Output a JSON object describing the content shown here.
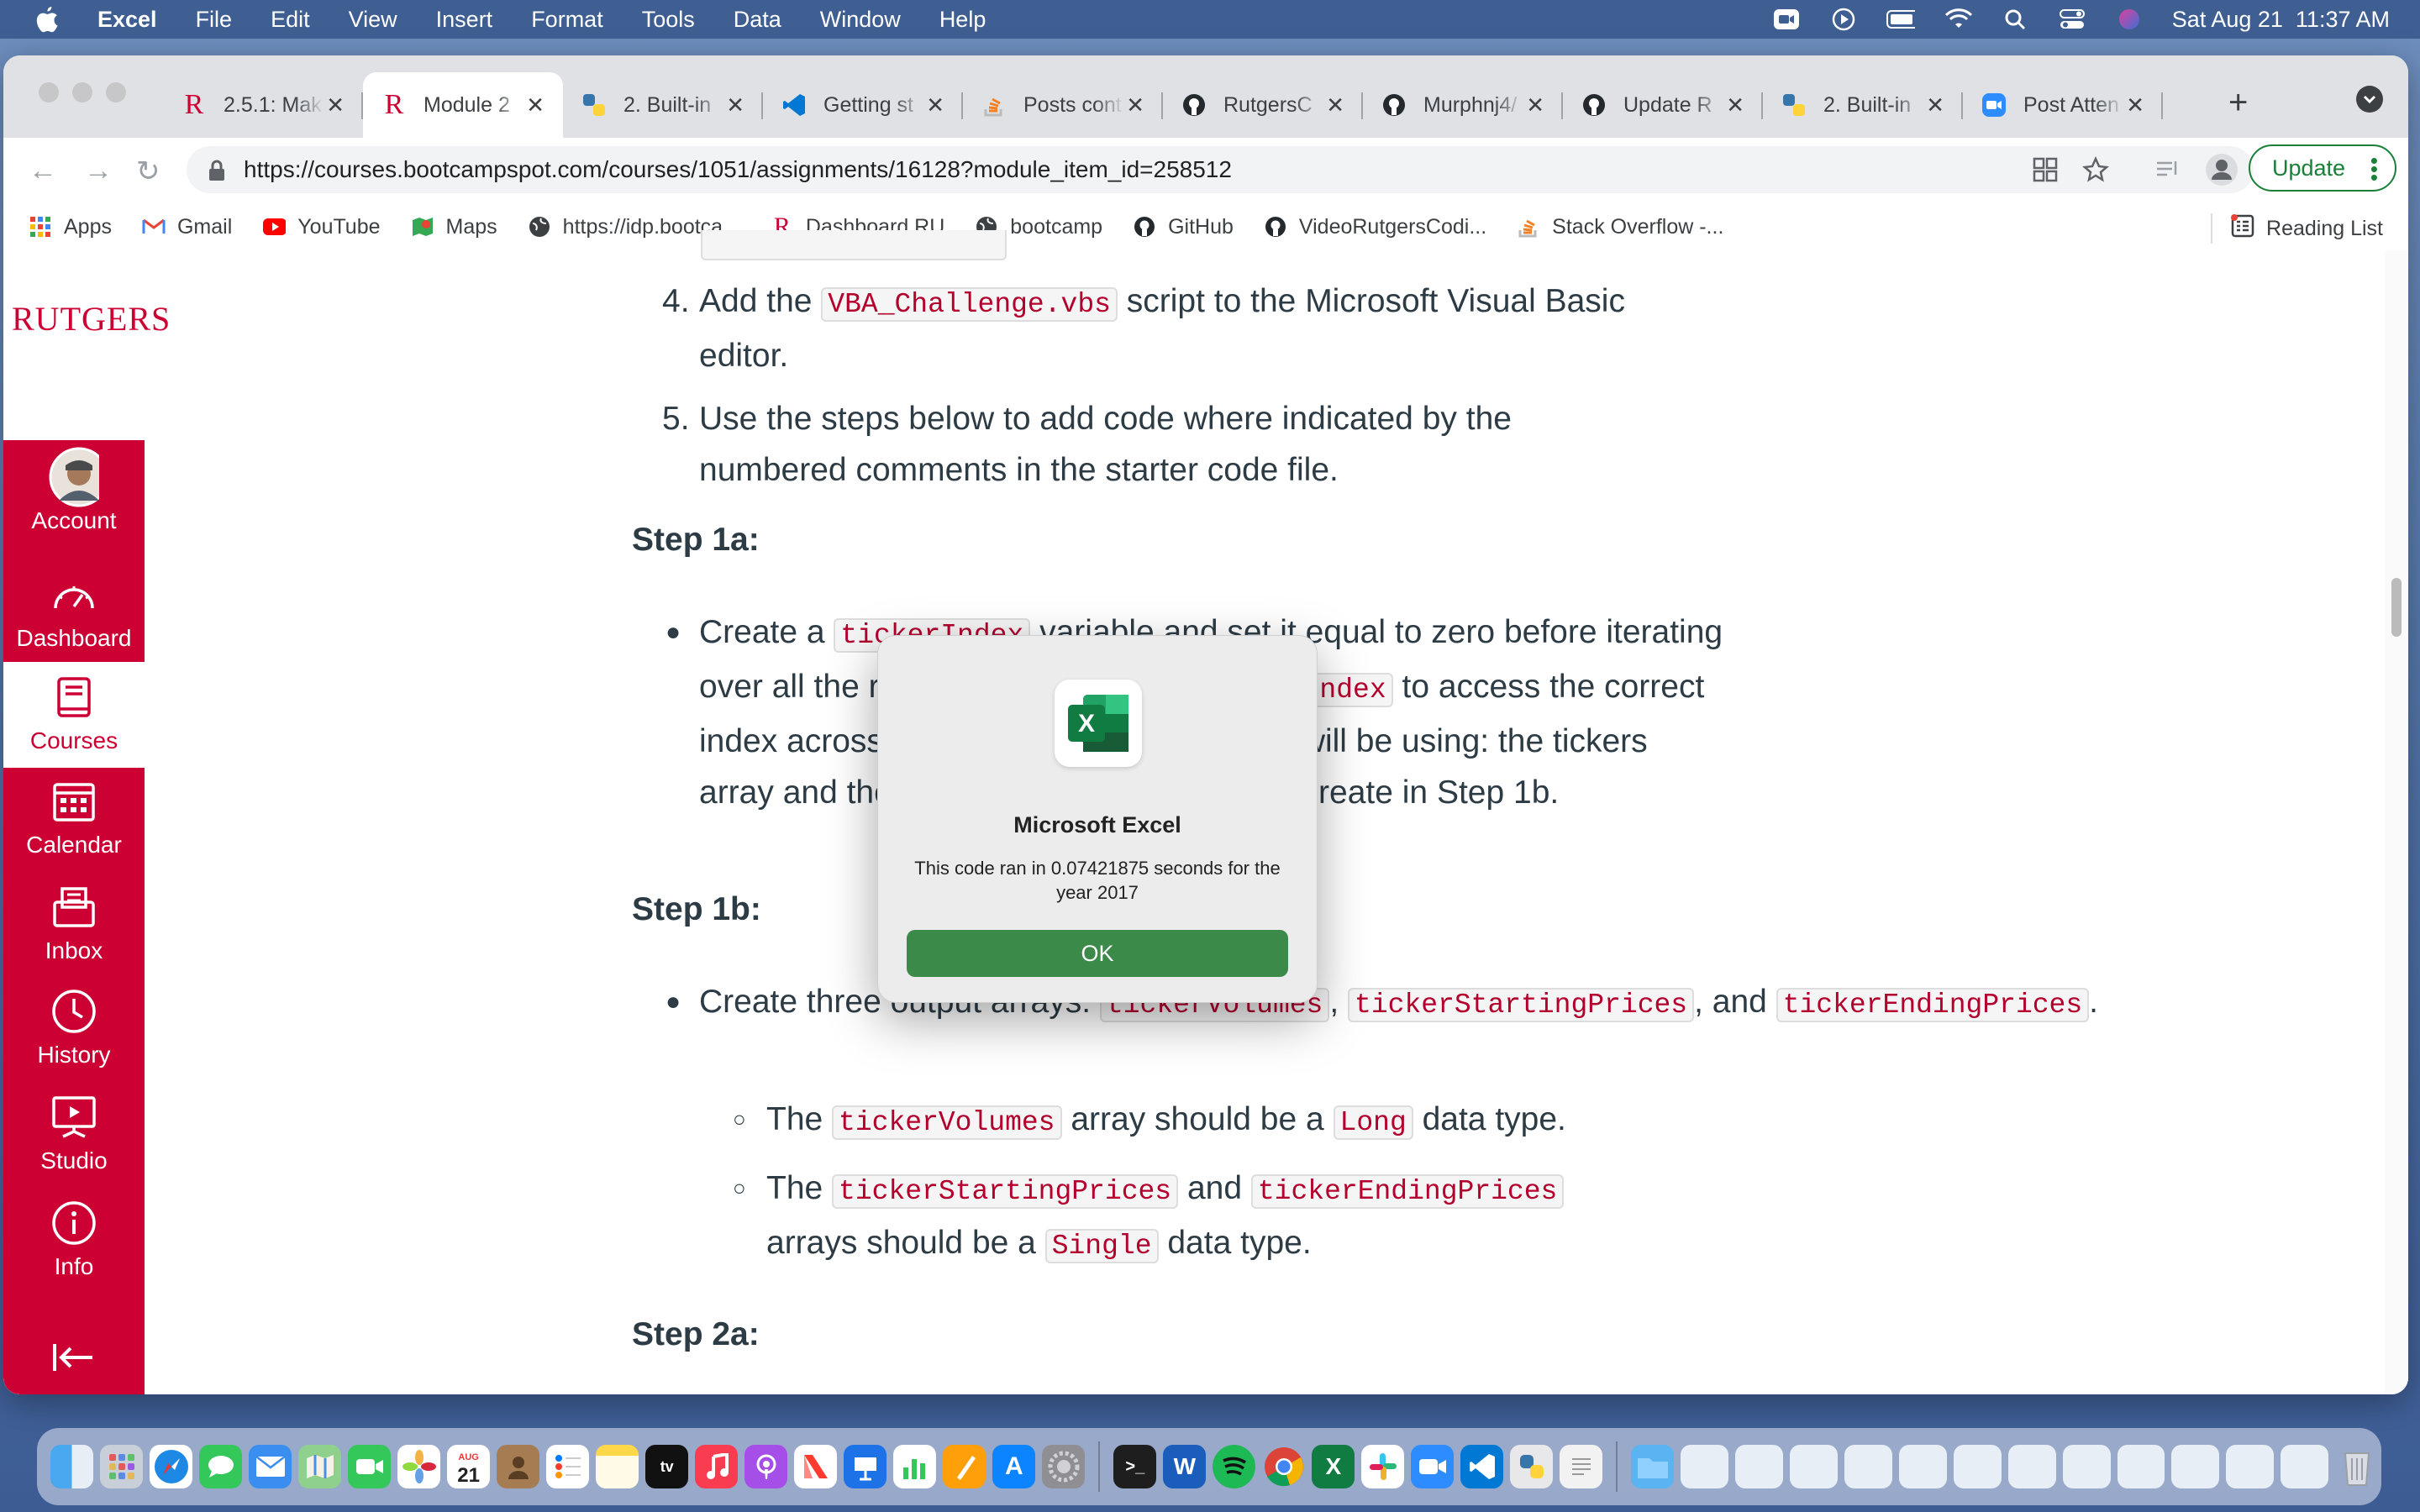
{
  "menubar": {
    "app_name": "Excel",
    "items": [
      "File",
      "Edit",
      "View",
      "Insert",
      "Format",
      "Tools",
      "Data",
      "Window",
      "Help"
    ],
    "clock": "Sat Aug 21  11:37 AM"
  },
  "browser": {
    "tabs": [
      {
        "title": "2.5.1: Mak",
        "icon": "rutgers-r-icon"
      },
      {
        "title": "Module 2",
        "icon": "rutgers-r-icon",
        "active": true
      },
      {
        "title": "2. Built-in",
        "icon": "python-icon"
      },
      {
        "title": "Getting st",
        "icon": "vscode-icon"
      },
      {
        "title": "Posts cont",
        "icon": "stackoverflow-icon"
      },
      {
        "title": "RutgersC",
        "icon": "github-icon"
      },
      {
        "title": "Murphnj4/",
        "icon": "github-icon"
      },
      {
        "title": "Update R",
        "icon": "github-icon"
      },
      {
        "title": "2. Built-in",
        "icon": "python-icon"
      },
      {
        "title": "Post Atten",
        "icon": "zoom-icon"
      }
    ],
    "url": "https://courses.bootcampspot.com/courses/1051/assignments/16128?module_item_id=258512",
    "update_label": "Update",
    "bookmarks": [
      {
        "label": "Apps",
        "icon": "apps-grid-icon"
      },
      {
        "label": "Gmail",
        "icon": "gmail-icon"
      },
      {
        "label": "YouTube",
        "icon": "youtube-icon"
      },
      {
        "label": "Maps",
        "icon": "maps-icon"
      },
      {
        "label": "https://idp.bootca...",
        "icon": "globe-icon"
      },
      {
        "label": "Dashboard RU",
        "icon": "rutgers-r-icon"
      },
      {
        "label": "bootcamp",
        "icon": "globe-icon"
      },
      {
        "label": "GitHub",
        "icon": "github-icon"
      },
      {
        "label": "VideoRutgersCodi...",
        "icon": "github-icon"
      },
      {
        "label": "Stack Overflow -...",
        "icon": "stackoverflow-icon"
      }
    ],
    "reading_list": "Reading List"
  },
  "lms": {
    "logo": "RUTGERS",
    "nav": [
      {
        "label": "Account",
        "icon": "avatar"
      },
      {
        "label": "Dashboard",
        "icon": "dashboard-gauge-icon"
      },
      {
        "label": "Courses",
        "icon": "courses-book-icon",
        "active": true
      },
      {
        "label": "Calendar",
        "icon": "calendar-icon"
      },
      {
        "label": "Inbox",
        "icon": "inbox-icon"
      },
      {
        "label": "History",
        "icon": "history-clock-icon"
      },
      {
        "label": "Studio",
        "icon": "studio-icon"
      },
      {
        "label": "Info",
        "icon": "info-icon"
      }
    ]
  },
  "assignment": {
    "step4": {
      "num": "4.",
      "pre": "Add the ",
      "code": "VBA_Challenge.vbs",
      "post": " script to the Microsoft Visual Basic editor."
    },
    "step5": {
      "num": "5.",
      "text": "Use the steps below to add code where indicated by the numbered comments in the starter code file."
    },
    "step1a_heading": "Step 1a:",
    "step1a": {
      "pre": "Create a ",
      "code1": "tickerIndex",
      "mid": " variable and set it equal to zero before iterating over all the rows. You will use this ",
      "code2": "tickerIndex",
      "post": " to access the correct index across the four different arrays you will be using: the tickers array and the three output arrays you will create in Step 1b."
    },
    "step1b_heading": "Step 1b:",
    "step1b": {
      "pre": "Create three output arrays: ",
      "code1": "tickerVolumes",
      "sep": ", ",
      "code2": "tickerStartingPrices",
      "and": ", and ",
      "code3": "tickerEndingPrices",
      "end": "."
    },
    "sub1": {
      "pre": "The ",
      "code1": "tickerVolumes",
      "mid": " array should be a ",
      "code2": "Long",
      "post": " data type."
    },
    "sub2": {
      "pre": "The ",
      "code1": "tickerStartingPrices",
      "mid": " and ",
      "code2": "tickerEndingPrices",
      "post": " arrays should be a ",
      "code3": "Single",
      "end": " data type."
    },
    "step2a_heading": "Step 2a:"
  },
  "dialog": {
    "title": "Microsoft Excel",
    "message": "This code ran in 0.07421875 seconds for the year 2017",
    "ok_label": "OK",
    "icon_letter": "X"
  },
  "dock": {
    "apps": [
      "Finder",
      "Launchpad",
      "Safari",
      "Messages",
      "Mail",
      "Maps",
      "FaceTime",
      "Photos",
      "Calendar",
      "Contacts",
      "Reminders",
      "Notes",
      "TV",
      "Music",
      "Podcasts",
      "News",
      "Keynote",
      "Numbers",
      "Pages",
      "App Store",
      "System Preferences",
      "Terminal",
      "Word",
      "Spotify",
      "Chrome",
      "Excel",
      "Slack",
      "Zoom",
      "VS Code",
      "Python",
      "TextEdit",
      "Downloads",
      "Trash"
    ],
    "calendar_day": "21",
    "calendar_month": "AUG"
  },
  "colors": {
    "rutgers_red": "#cc0033",
    "excel_green": "#3b8a4a",
    "code_text": "#b3002d",
    "chrome_update_green": "#188038"
  }
}
